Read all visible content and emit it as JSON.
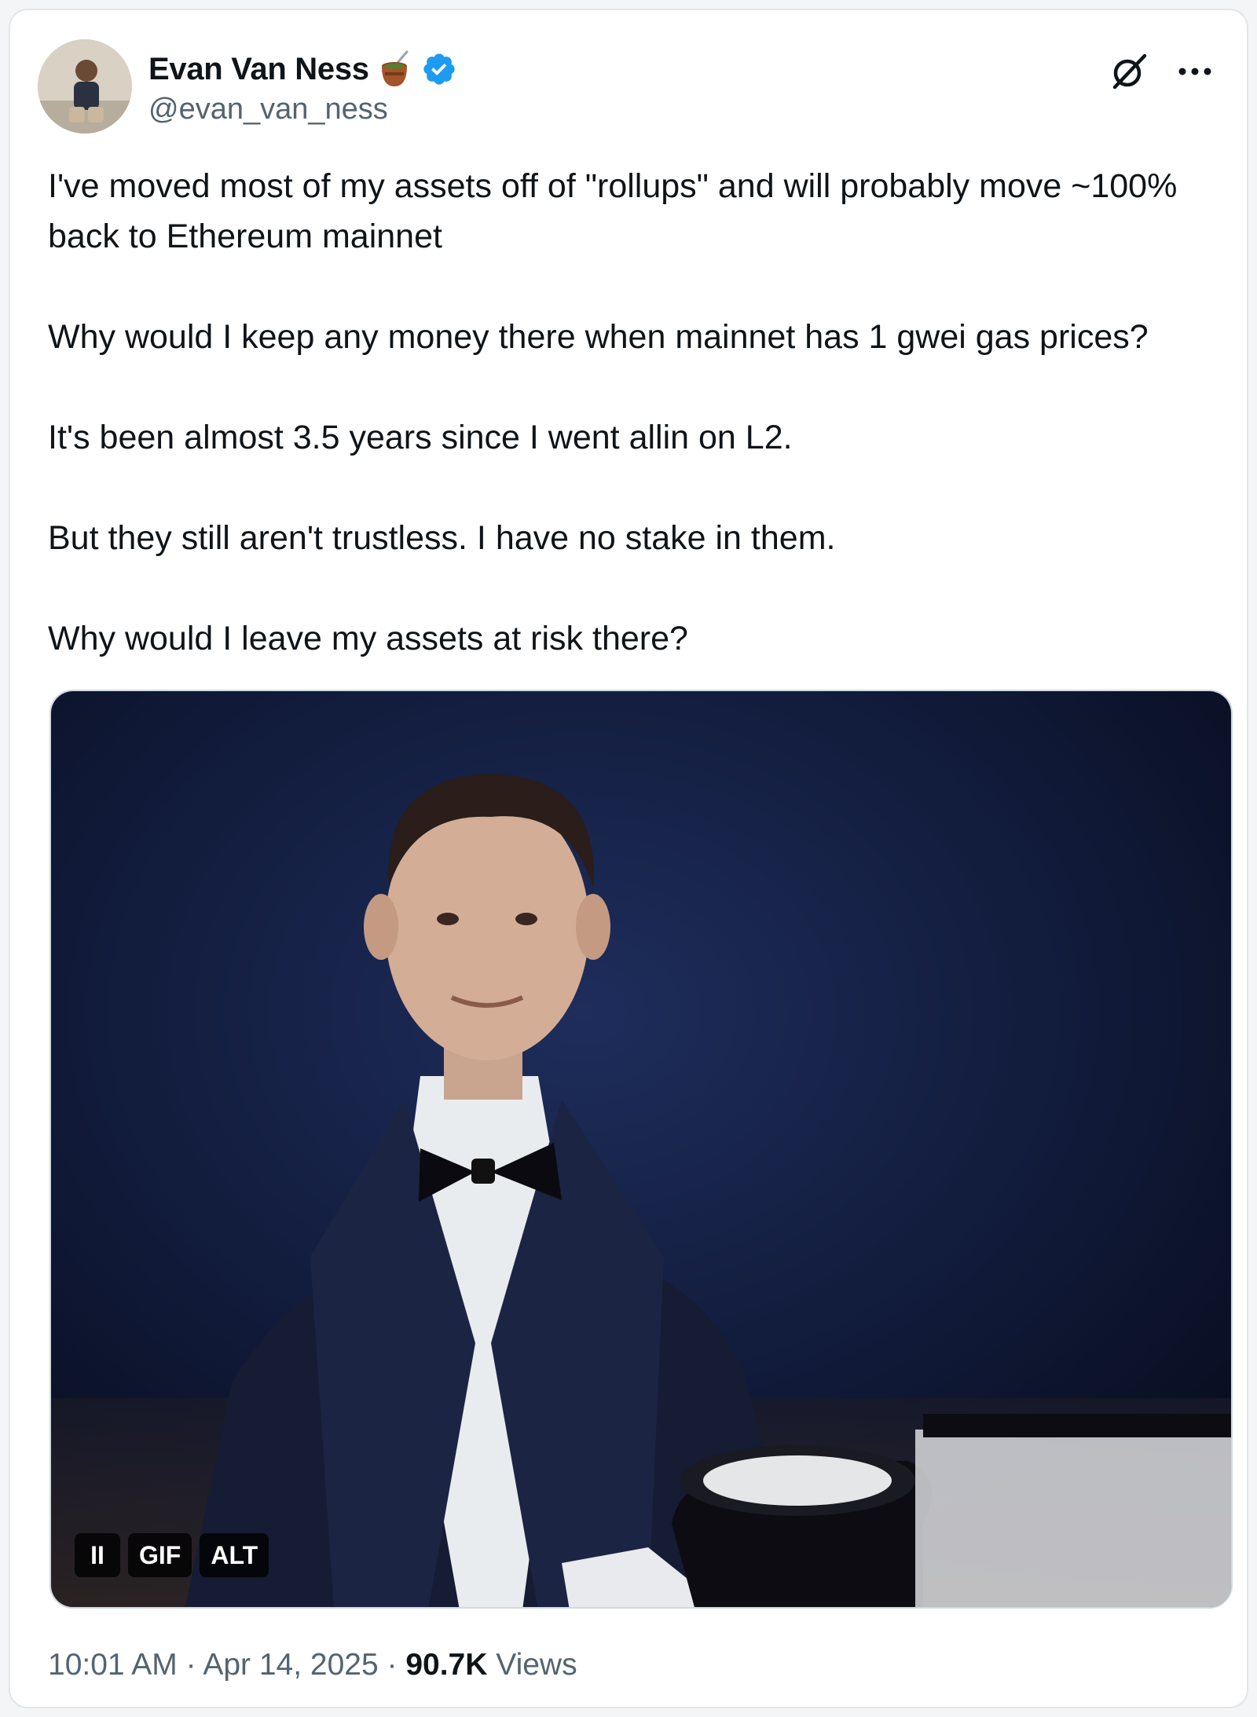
{
  "author": {
    "name": "Evan Van Ness",
    "handle": "@evan_van_ness",
    "verified": true,
    "emoji_icon": "mate-drink-icon"
  },
  "icons": {
    "grok": "grok-icon",
    "more": "more-icon",
    "verified": "verified-badge-icon"
  },
  "tweet": {
    "paragraphs": [
      "I've moved most of my assets off of \"rollups\" and will probably move ~100% back to Ethereum mainnet",
      "Why would I keep any money there when mainnet has 1 gwei gas prices?",
      "It's been almost 3.5 years since I went allin on L2.",
      "But they still aren't trustless.  I have no stake in them.",
      "Why would I leave my assets at risk there?"
    ]
  },
  "media": {
    "pause_label": "II",
    "gif_label": "GIF",
    "alt_label": "ALT"
  },
  "meta": {
    "time": "10:01 AM",
    "separator": "·",
    "date": "Apr 14, 2025",
    "views_count": "90.7K",
    "views_label": "Views"
  },
  "colors": {
    "accent": "#1d9bf0",
    "text_primary": "#0f1419",
    "text_secondary": "#536471",
    "border": "#cfd9de"
  }
}
